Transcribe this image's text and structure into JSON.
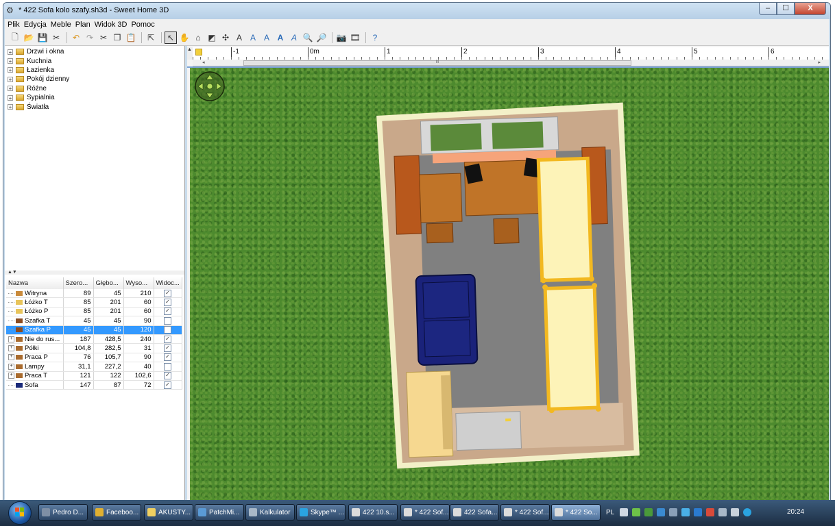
{
  "window": {
    "title": "* 422 Sofa kolo szafy.sh3d - Sweet Home 3D",
    "min_label": "–",
    "max_label": "☐",
    "close_label": "X"
  },
  "menu": [
    "Plik",
    "Edycja",
    "Meble",
    "Plan",
    "Widok 3D",
    "Pomoc"
  ],
  "catalog": {
    "categories": [
      "Drzwi i okna",
      "Kuchnia",
      "Łazienka",
      "Pokój dzienny",
      "Różne",
      "Sypialnia",
      "Światła"
    ]
  },
  "furniture_table": {
    "columns": [
      "Nazwa",
      "Szero...",
      "Głębo...",
      "Wyso...",
      "Widoc..."
    ],
    "rows": [
      {
        "name": "Witryna",
        "w": "89",
        "d": "45",
        "h": "210",
        "visible": true,
        "group": false,
        "icon_color": "#c98a3a"
      },
      {
        "name": "Łóżko T",
        "w": "85",
        "d": "201",
        "h": "60",
        "visible": true,
        "group": false,
        "icon_color": "#e8c45a"
      },
      {
        "name": "Łóżko P",
        "w": "85",
        "d": "201",
        "h": "60",
        "visible": true,
        "group": false,
        "icon_color": "#e8c45a"
      },
      {
        "name": "Szafka T",
        "w": "45",
        "d": "45",
        "h": "90",
        "visible": false,
        "group": false,
        "icon_color": "#8a4b20"
      },
      {
        "name": "Szafka P",
        "w": "45",
        "d": "45",
        "h": "120",
        "visible": false,
        "group": false,
        "icon_color": "#8a4b20",
        "selected": true
      },
      {
        "name": "Nie do rus...",
        "w": "187",
        "d": "428,5",
        "h": "240",
        "visible": true,
        "group": true,
        "icon_color": "#a96b2e"
      },
      {
        "name": "Półki",
        "w": "104,8",
        "d": "282,5",
        "h": "31",
        "visible": true,
        "group": true,
        "icon_color": "#a96b2e"
      },
      {
        "name": "Praca P",
        "w": "76",
        "d": "105,7",
        "h": "90",
        "visible": true,
        "group": true,
        "icon_color": "#a96b2e"
      },
      {
        "name": "Lampy",
        "w": "31,1",
        "d": "227,2",
        "h": "40",
        "visible": false,
        "group": true,
        "icon_color": "#a96b2e"
      },
      {
        "name": "Praca T",
        "w": "121",
        "d": "122",
        "h": "102,6",
        "visible": true,
        "group": true,
        "icon_color": "#a96b2e"
      },
      {
        "name": "Sofa",
        "w": "147",
        "d": "87",
        "h": "72",
        "visible": true,
        "group": false,
        "icon_color": "#1a2a7a"
      }
    ]
  },
  "ruler": {
    "labels": [
      "-1",
      "0m",
      "1",
      "2",
      "3",
      "4",
      "5",
      "6"
    ]
  },
  "scrollbar_grip": "III",
  "taskbar": {
    "buttons": [
      {
        "label": "Pedro D...",
        "icon_color": "#7e8fa5"
      },
      {
        "label": "Faceboo...",
        "icon_color": "#e0b030"
      },
      {
        "label": "AKUSTY...",
        "icon_color": "#f0d060"
      },
      {
        "label": "PatchMi...",
        "icon_color": "#5a9ad5"
      },
      {
        "label": "Kalkulator",
        "icon_color": "#a8b8c8"
      },
      {
        "label": "Skype™ ...",
        "icon_color": "#2aa3e0"
      },
      {
        "label": "422 10.s...",
        "icon_color": "#dcdcdc"
      },
      {
        "label": "* 422 Sof...",
        "icon_color": "#dcdcdc"
      },
      {
        "label": "422 Sofa...",
        "icon_color": "#dcdcdc"
      },
      {
        "label": "* 422 Sof...",
        "icon_color": "#dcdcdc"
      },
      {
        "label": "* 422 So...",
        "icon_color": "#dcdcdc",
        "active": true
      }
    ],
    "language": "PL",
    "clock": "20:24"
  },
  "colors": {
    "grass": "#4d8a2e",
    "wall": "#d4b89a",
    "floor": "#8a8a8a",
    "selection": "#3399ff"
  }
}
